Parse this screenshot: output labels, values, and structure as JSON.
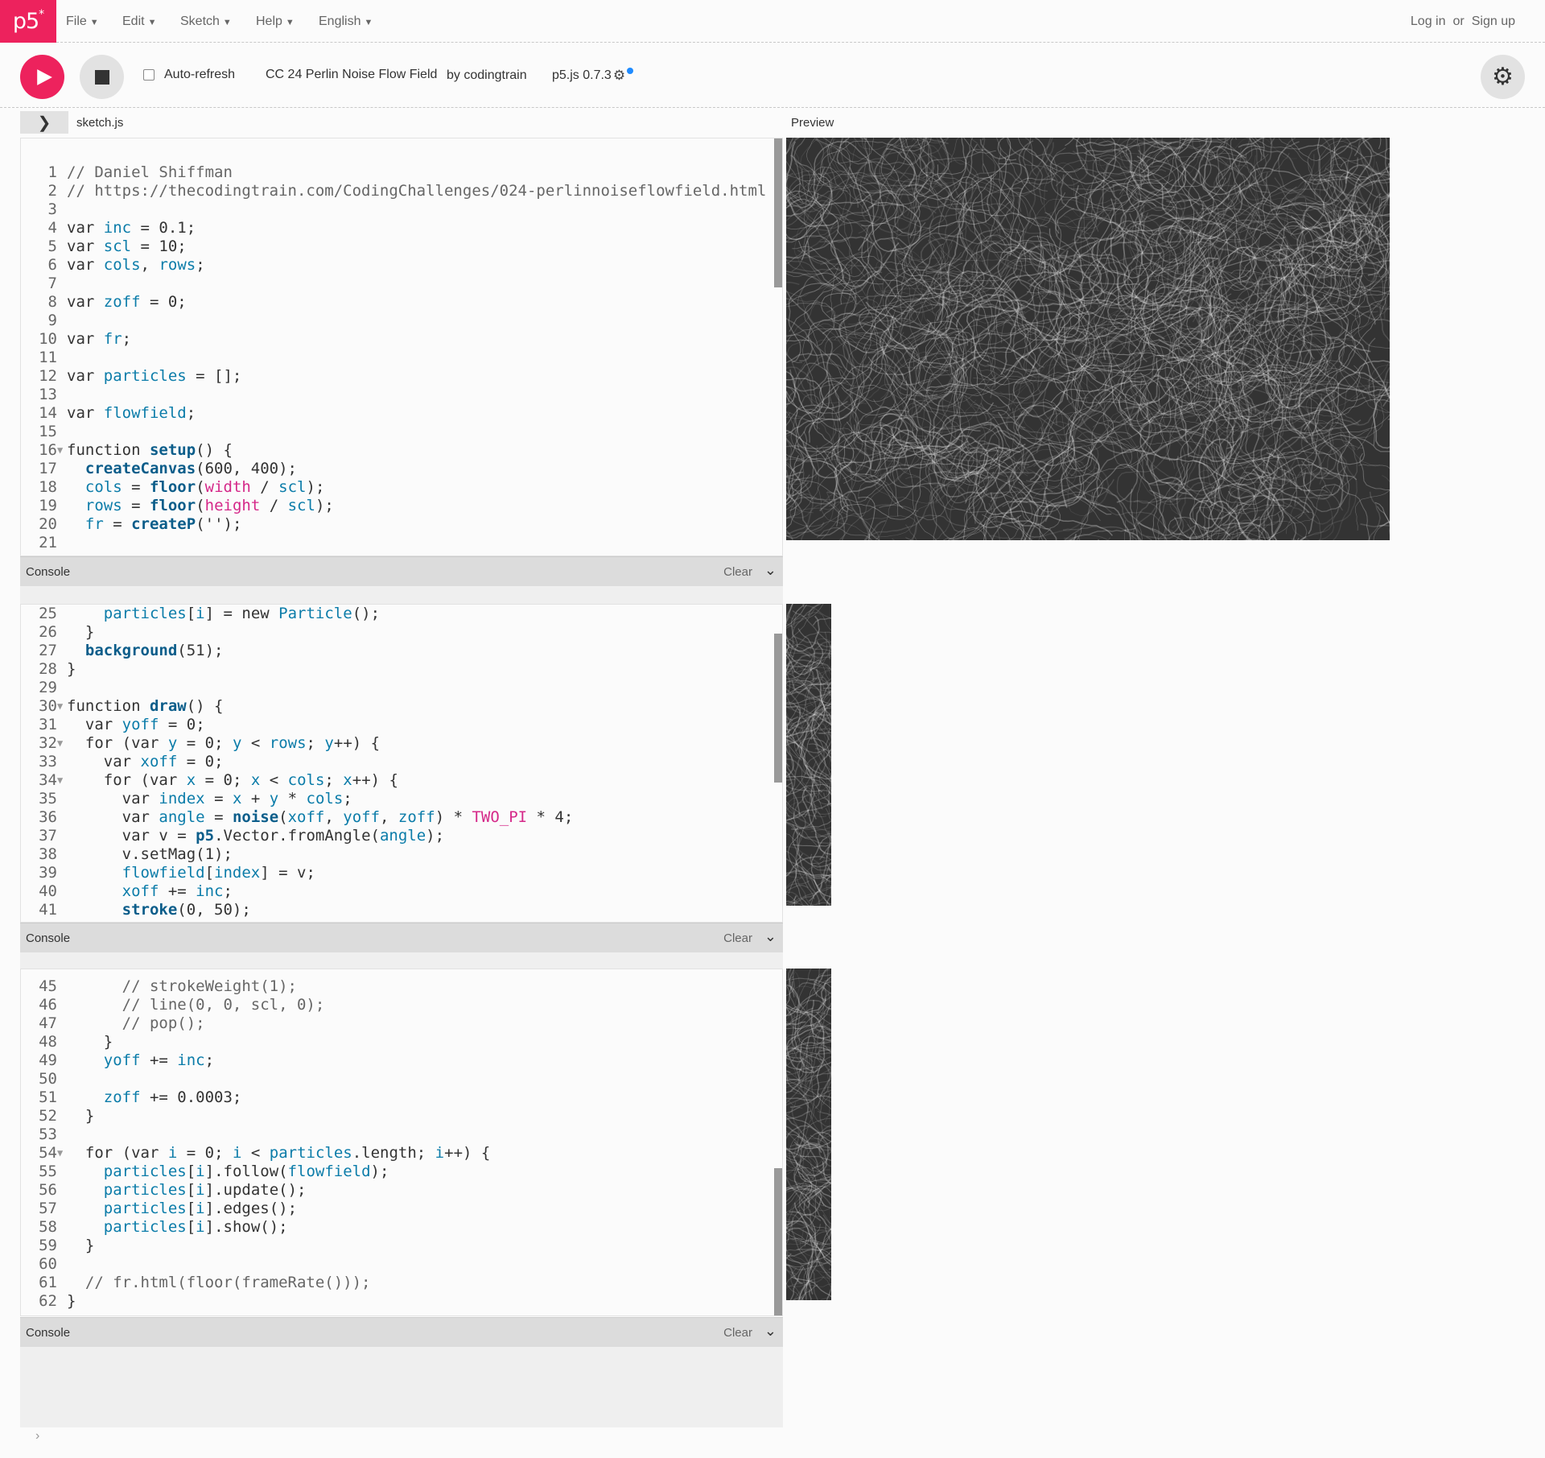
{
  "nav": {
    "logo": "p5",
    "logo_sup": "*",
    "menus": [
      {
        "label": "File"
      },
      {
        "label": "Edit"
      },
      {
        "label": "Sketch"
      },
      {
        "label": "Help"
      },
      {
        "label": "English"
      }
    ],
    "login": "Log in",
    "or": "or",
    "signup": "Sign up"
  },
  "toolbar": {
    "auto_refresh": "Auto-refresh",
    "sketch_title": "CC 24 Perlin Noise Flow Field",
    "owner": "by codingtrain",
    "version": "p5.js 0.7.3",
    "auto_refresh_checked": false
  },
  "tabs": {
    "file": "sketch.js",
    "preview": "Preview"
  },
  "console": {
    "title": "Console",
    "clear": "Clear"
  },
  "colors": {
    "accent": "#ed225d",
    "canvas_bg": "#333333"
  },
  "editor_1": [
    {
      "n": "1",
      "t": "// Daniel Shiffman"
    },
    {
      "n": "2",
      "t": "// https://thecodingtrain.com/CodingChallenges/024-perlinnoiseflowfield.html"
    },
    {
      "n": "3",
      "t": ""
    },
    {
      "n": "4",
      "t": "var inc = 0.1;"
    },
    {
      "n": "5",
      "t": "var scl = 10;"
    },
    {
      "n": "6",
      "t": "var cols, rows;"
    },
    {
      "n": "7",
      "t": ""
    },
    {
      "n": "8",
      "t": "var zoff = 0;"
    },
    {
      "n": "9",
      "t": ""
    },
    {
      "n": "10",
      "t": "var fr;"
    },
    {
      "n": "11",
      "t": ""
    },
    {
      "n": "12",
      "t": "var particles = [];"
    },
    {
      "n": "13",
      "t": ""
    },
    {
      "n": "14",
      "t": "var flowfield;"
    },
    {
      "n": "15",
      "t": ""
    },
    {
      "n": "16",
      "t": "function setup() {"
    },
    {
      "n": "17",
      "t": "  createCanvas(600, 400);"
    },
    {
      "n": "18",
      "t": "  cols = floor(width / scl);"
    },
    {
      "n": "19",
      "t": "  rows = floor(height / scl);"
    },
    {
      "n": "20",
      "t": "  fr = createP('');"
    },
    {
      "n": "21",
      "t": ""
    }
  ],
  "editor_2": [
    {
      "n": "25",
      "t": "    particles[i] = new Particle();"
    },
    {
      "n": "26",
      "t": "  }"
    },
    {
      "n": "27",
      "t": "  background(51);"
    },
    {
      "n": "28",
      "t": "}"
    },
    {
      "n": "29",
      "t": ""
    },
    {
      "n": "30",
      "t": "function draw() {"
    },
    {
      "n": "31",
      "t": "  var yoff = 0;"
    },
    {
      "n": "32",
      "t": "  for (var y = 0; y < rows; y++) {"
    },
    {
      "n": "33",
      "t": "    var xoff = 0;"
    },
    {
      "n": "34",
      "t": "    for (var x = 0; x < cols; x++) {"
    },
    {
      "n": "35",
      "t": "      var index = x + y * cols;"
    },
    {
      "n": "36",
      "t": "      var angle = noise(xoff, yoff, zoff) * TWO_PI * 4;"
    },
    {
      "n": "37",
      "t": "      var v = p5.Vector.fromAngle(angle);"
    },
    {
      "n": "38",
      "t": "      v.setMag(1);"
    },
    {
      "n": "39",
      "t": "      flowfield[index] = v;"
    },
    {
      "n": "40",
      "t": "      xoff += inc;"
    },
    {
      "n": "41",
      "t": "      stroke(0, 50);"
    }
  ],
  "editor_3": [
    {
      "n": "45",
      "t": "      // strokeWeight(1);"
    },
    {
      "n": "46",
      "t": "      // line(0, 0, scl, 0);"
    },
    {
      "n": "47",
      "t": "      // pop();"
    },
    {
      "n": "48",
      "t": "    }"
    },
    {
      "n": "49",
      "t": "    yoff += inc;"
    },
    {
      "n": "50",
      "t": ""
    },
    {
      "n": "51",
      "t": "    zoff += 0.0003;"
    },
    {
      "n": "52",
      "t": "  }"
    },
    {
      "n": "53",
      "t": ""
    },
    {
      "n": "54",
      "t": "  for (var i = 0; i < particles.length; i++) {"
    },
    {
      "n": "55",
      "t": "    particles[i].follow(flowfield);"
    },
    {
      "n": "56",
      "t": "    particles[i].update();"
    },
    {
      "n": "57",
      "t": "    particles[i].edges();"
    },
    {
      "n": "58",
      "t": "    particles[i].show();"
    },
    {
      "n": "59",
      "t": "  }"
    },
    {
      "n": "60",
      "t": ""
    },
    {
      "n": "61",
      "t": "  // fr.html(floor(frameRate()));"
    },
    {
      "n": "62",
      "t": "}"
    }
  ],
  "console_prompt": "›"
}
